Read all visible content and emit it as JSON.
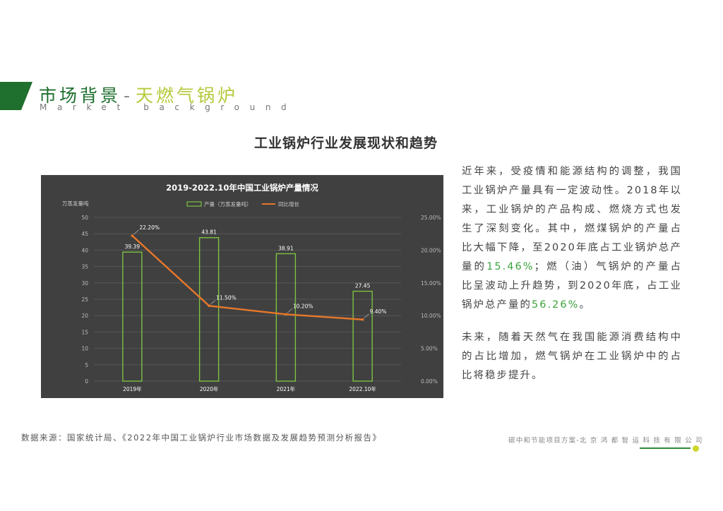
{
  "header": {
    "title": "市场背景",
    "separator": "-",
    "subtitle": "天燃气锅炉",
    "en": "Market background"
  },
  "main_title": "工业锅炉行业发展现状和趋势",
  "colors": {
    "brand_green": "#1f6f2e",
    "accent_yellow_green": "#b5c93a",
    "bar_outline": "#7cc142",
    "line_orange": "#e8782a",
    "highlight_green": "#3aa23a",
    "chart_bg": "#404040"
  },
  "chart_data": {
    "type": "bar+line",
    "title": "2019-2022.10年中国工业锅炉产量情况",
    "ylabel": "万蒸发量吨",
    "categories": [
      "2019年",
      "2020年",
      "2021年",
      "2022.10年"
    ],
    "ylim": [
      0,
      50
    ],
    "y_ticks": [
      "0",
      "5",
      "10",
      "15",
      "20",
      "25",
      "30",
      "35",
      "40",
      "45",
      "50"
    ],
    "y2lim": [
      0,
      25
    ],
    "y2_ticks": [
      "0.00%",
      "5.00%",
      "10.00%",
      "15.00%",
      "20.00%",
      "25.00%"
    ],
    "grid": true,
    "legend_position": "top",
    "series": [
      {
        "name": "产量（万蒸发量吨）",
        "type": "bar",
        "axis": "left",
        "values": [
          39.39,
          43.81,
          38.91,
          27.45
        ],
        "labels": [
          "39.39",
          "43.81",
          "38.91",
          "27.45"
        ]
      },
      {
        "name": "同比增长",
        "type": "line",
        "axis": "right",
        "values": [
          22.2,
          11.5,
          10.2,
          9.4
        ],
        "labels": [
          "22.20%",
          "11.50%",
          "10.20%",
          "9.40%"
        ]
      }
    ]
  },
  "side_text": {
    "p1_a": "近年来，受疫情和能源结构的调整，我国工业锅炉产量具有一定波动性。2018年以来，工业锅炉的产品构成、燃烧方式也发生了深刻变化。其中，燃煤锅炉的产量占比大幅下降，至2020年底占工业锅炉总产量的",
    "p1_h1": "15.46%",
    "p1_b": "；燃（油）气锅炉的产量占比呈波动上升趋势，到2020年底，占工业锅炉总产量的",
    "p1_h2": "56.26%",
    "p1_c": "。",
    "p2": "未来，随着天然气在我国能源消费结构中的占比增加，燃气锅炉在工业锅炉中的占比将稳步提升。"
  },
  "source": "数据来源：国家统计局、《2022年中国工业锅炉行业市场数据及发展趋势预测分析报告》",
  "footer_note": "碳中和节能项目方案-北 京 鸿 都 智 运 科 技 有 限 公 司"
}
